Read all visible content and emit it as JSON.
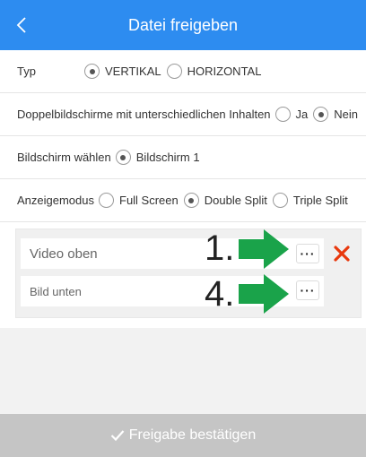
{
  "header": {
    "title": "Datei freigeben",
    "back_icon": "chevron-left-icon",
    "background": "#2d8cf0"
  },
  "type_row": {
    "label": "Typ",
    "options": [
      {
        "label": "VERTIKAL",
        "selected": true
      },
      {
        "label": "HORIZONTAL",
        "selected": false
      }
    ]
  },
  "dual_row": {
    "label": "Doppelbildschirme mit unterschiedlichen Inhalten",
    "options": [
      {
        "label": "Ja",
        "selected": false
      },
      {
        "label": "Nein",
        "selected": true
      }
    ]
  },
  "screen_row": {
    "label": "Bildschirm wählen",
    "options": [
      {
        "label": "Bildschirm 1",
        "selected": true
      }
    ]
  },
  "mode_row": {
    "label": "Anzeigemodus",
    "options": [
      {
        "label": "Full Screen",
        "selected": false
      },
      {
        "label": "Double Split",
        "selected": true
      },
      {
        "label": "Triple Split",
        "selected": false
      }
    ]
  },
  "content": {
    "items": [
      {
        "label": "Video oben",
        "more_label": "···",
        "step": "1."
      },
      {
        "label": "Bild unten",
        "more_label": "···",
        "step": "4."
      }
    ],
    "delete_icon": "close-x-icon",
    "delete_color": "#e8380d",
    "arrow_color": "#1aa34a"
  },
  "footer": {
    "confirm_label": "Freigabe bestätigen",
    "check_icon": "checkmark-icon",
    "background": "#c5c5c5"
  }
}
